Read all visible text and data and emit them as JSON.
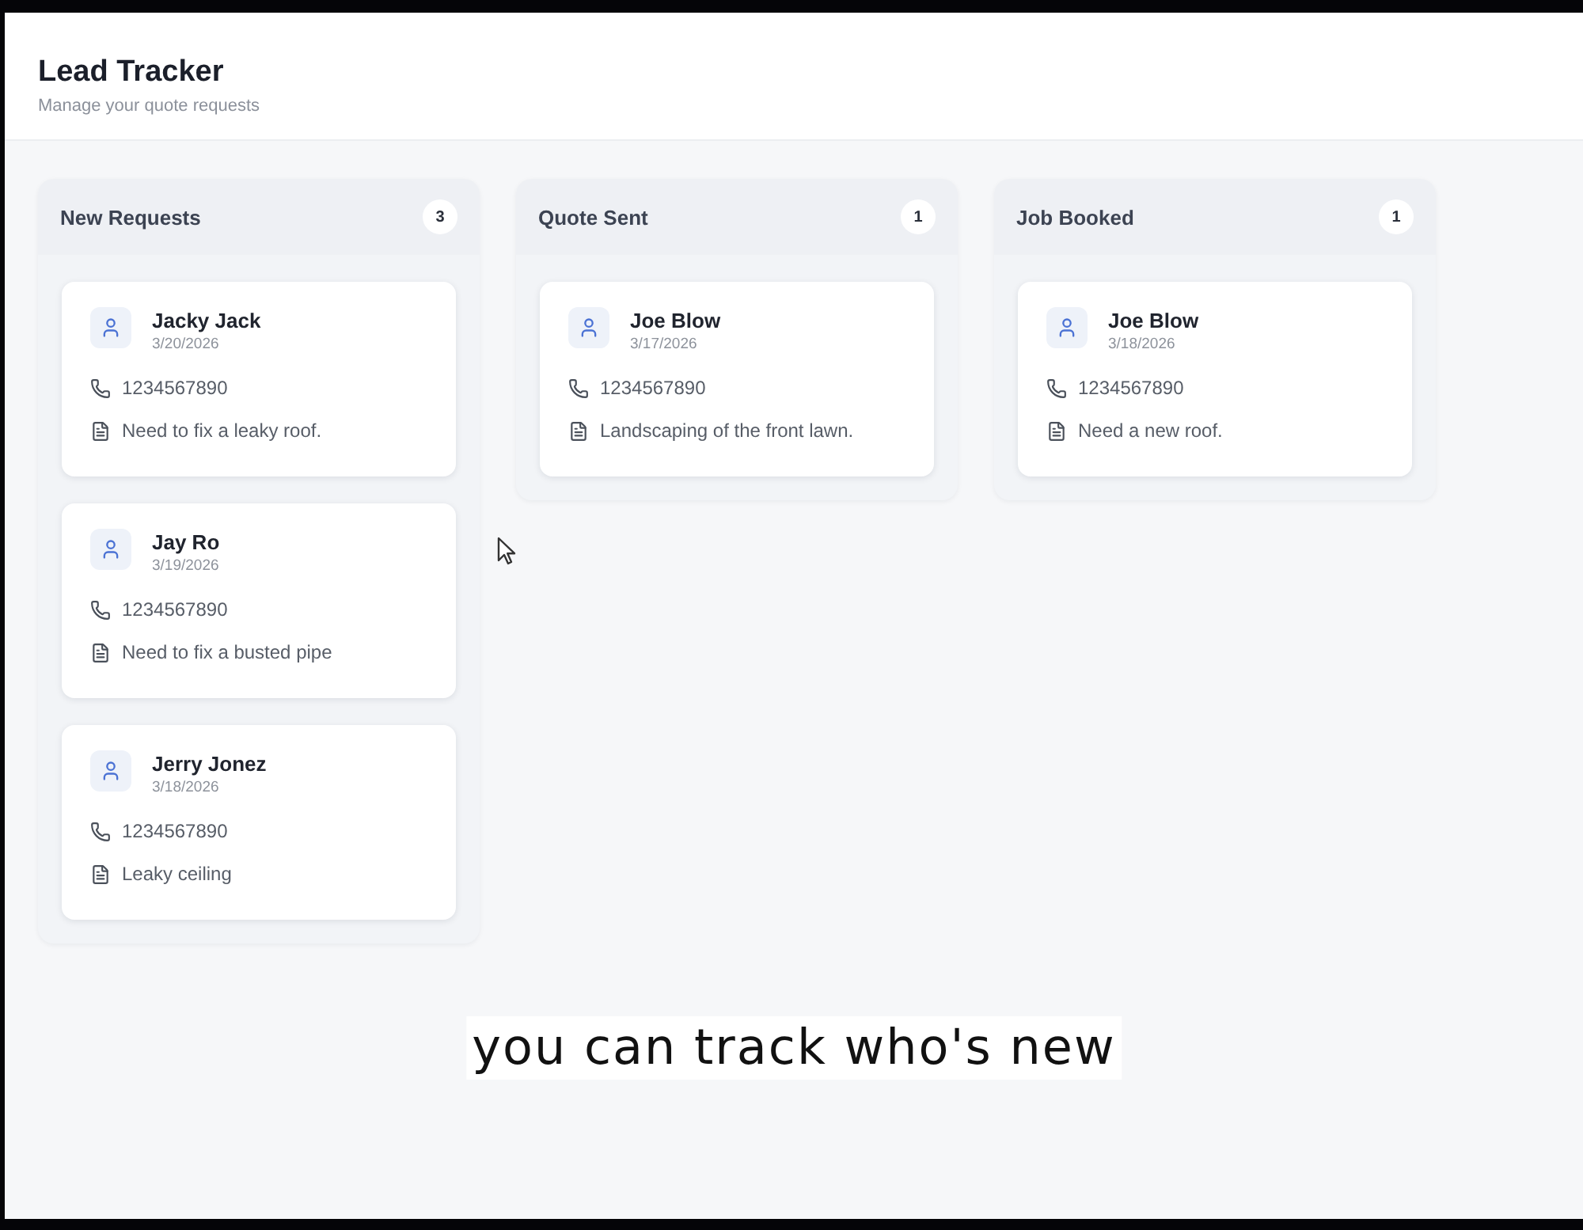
{
  "header": {
    "title": "Lead Tracker",
    "subtitle": "Manage your quote requests"
  },
  "columns": [
    {
      "title": "New Requests",
      "count": "3",
      "leads": [
        {
          "name": "Jacky Jack",
          "date": "3/20/2026",
          "phone": "1234567890",
          "note": "Need to fix a leaky roof."
        },
        {
          "name": "Jay Ro",
          "date": "3/19/2026",
          "phone": "1234567890",
          "note": "Need to fix a busted pipe"
        },
        {
          "name": "Jerry Jonez",
          "date": "3/18/2026",
          "phone": "1234567890",
          "note": "Leaky ceiling"
        }
      ]
    },
    {
      "title": "Quote Sent",
      "count": "1",
      "leads": [
        {
          "name": "Joe Blow",
          "date": "3/17/2026",
          "phone": "1234567890",
          "note": "Landscaping of the front lawn."
        }
      ]
    },
    {
      "title": "Job Booked",
      "count": "1",
      "leads": [
        {
          "name": "Joe Blow",
          "date": "3/18/2026",
          "phone": "1234567890",
          "note": "Need a new roof."
        }
      ]
    }
  ],
  "caption": "you can track who's new"
}
